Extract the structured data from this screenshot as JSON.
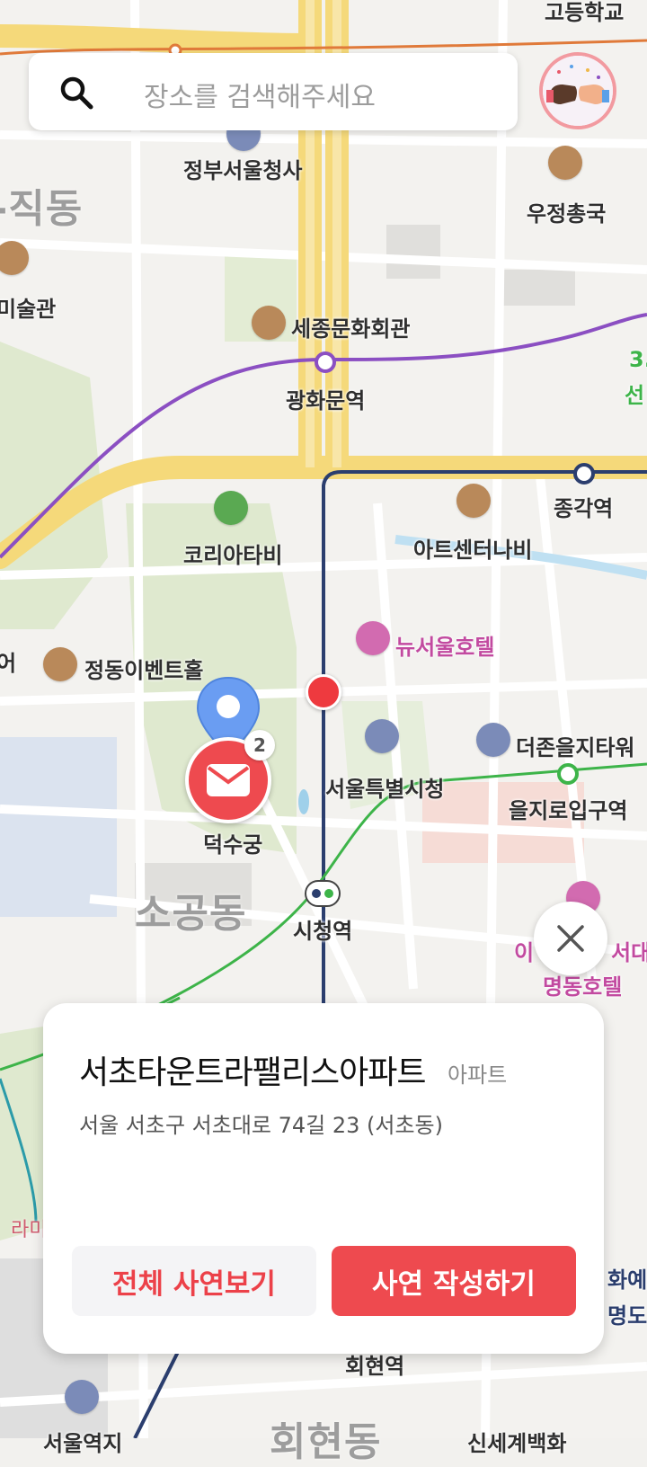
{
  "search": {
    "placeholder": "장소를 검색해주세요"
  },
  "map": {
    "labels": {
      "top_school": "고등학교",
      "gov_complex": "정부서울청사",
      "sajik": "-직동",
      "post": "우정총국",
      "museum": "미술관",
      "sejong": "세종문화회관",
      "gwanghwamun": "광화문역",
      "line3": "3.",
      "line3b": "선",
      "jonggak": "종각역",
      "korea_tv": "코리아타비",
      "artcenter": "아트센터나비",
      "newseoul": "뉴서울호텔",
      "jeongdong": "정동이벤트홀",
      "eo": "어",
      "cityhall": "서울특별시청",
      "theone": "더존을지타워",
      "euljiro": "을지로입구역",
      "deoksugung": "덕수궁",
      "sogong": "소공동",
      "cityhall_station": "시청역",
      "myeongdong_hotel": "명동호텔",
      "i": "이",
      "seodae": "서대",
      "rami": "라미",
      "hwaye": "화예",
      "myeongdo": "명도",
      "hoehyeon_station": "회현역",
      "seoul_station": "서울역지",
      "hoehyeon": "회현동",
      "bottom_right": "신세계백화"
    },
    "pin_badge": "2"
  },
  "card": {
    "title": "서초타운트라팰리스아파트",
    "type": "아파트",
    "address": "서울 서초구 서초대로 74길 23 (서초동)",
    "btn_all": "전체 사연보기",
    "btn_write": "사연 작성하기"
  },
  "colors": {
    "accent": "#EE4A4F",
    "pin": "#6A9DF2",
    "line5": "#8B4FC2",
    "line1": "#2B3E6E",
    "line2": "#3DB449"
  }
}
